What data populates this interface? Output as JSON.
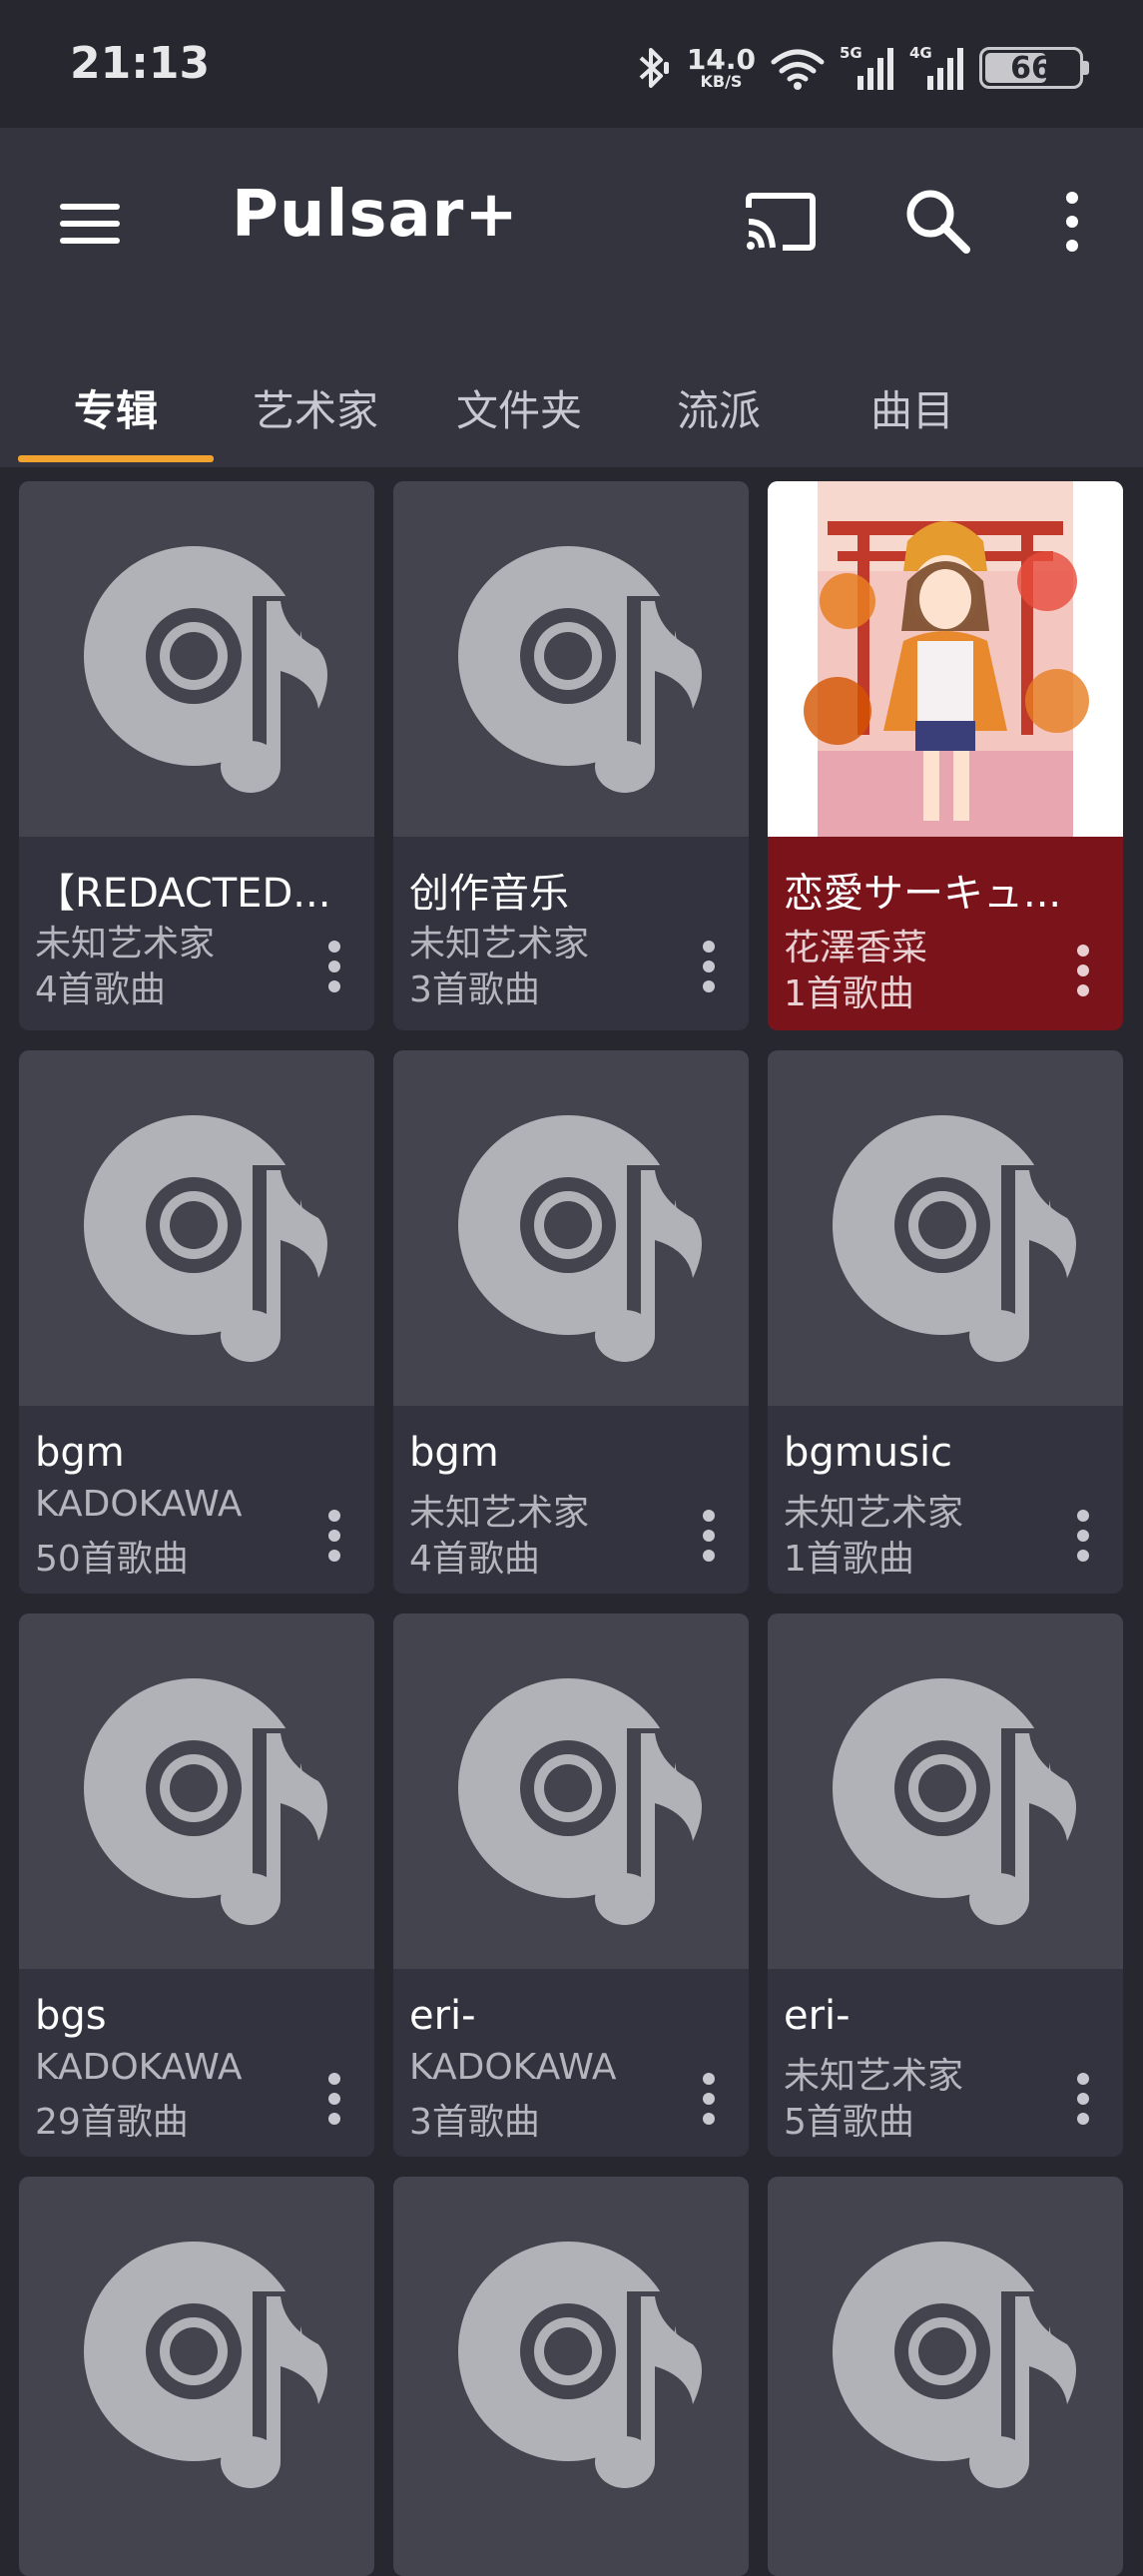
{
  "status_bar": {
    "time": "21:13",
    "net_speed_value": "14.0",
    "net_speed_unit": "KB/S",
    "signal_1_label": "5G",
    "signal_2_label": "4G",
    "battery_level": "66"
  },
  "app_bar": {
    "title": "Pulsar+"
  },
  "tabs": [
    {
      "label": "专辑",
      "active": true
    },
    {
      "label": "艺术家",
      "active": false
    },
    {
      "label": "文件夹",
      "active": false
    },
    {
      "label": "流派",
      "active": false
    },
    {
      "label": "曲目",
      "active": false
    }
  ],
  "colors": {
    "accent": "#f2a32f",
    "highlight_card": "#7a131a",
    "background": "#27272f",
    "app_bar": "#34343f",
    "placeholder_icon": "#b1b1b8"
  },
  "albums": [
    {
      "title": "【REDACTED...",
      "artist": "未知艺术家",
      "count": "4首歌曲"
    },
    {
      "title": "创作音乐",
      "artist": "未知艺术家",
      "count": "3首歌曲"
    },
    {
      "title": "恋愛サーキュ...",
      "artist": "花澤香菜",
      "count": "1首歌曲",
      "highlight": true,
      "cover": "anime-girl-torii-autumn-art"
    },
    {
      "title": "bgm",
      "artist": "KADOKAWA",
      "count": "50首歌曲"
    },
    {
      "title": "bgm",
      "artist": "未知艺术家",
      "count": "4首歌曲"
    },
    {
      "title": "bgmusic",
      "artist": "未知艺术家",
      "count": "1首歌曲"
    },
    {
      "title": "bgs",
      "artist": "KADOKAWA",
      "count": "29首歌曲"
    },
    {
      "title": "eri-",
      "artist": "KADOKAWA",
      "count": "3首歌曲"
    },
    {
      "title": "eri-",
      "artist": "未知艺术家",
      "count": "5首歌曲"
    }
  ]
}
